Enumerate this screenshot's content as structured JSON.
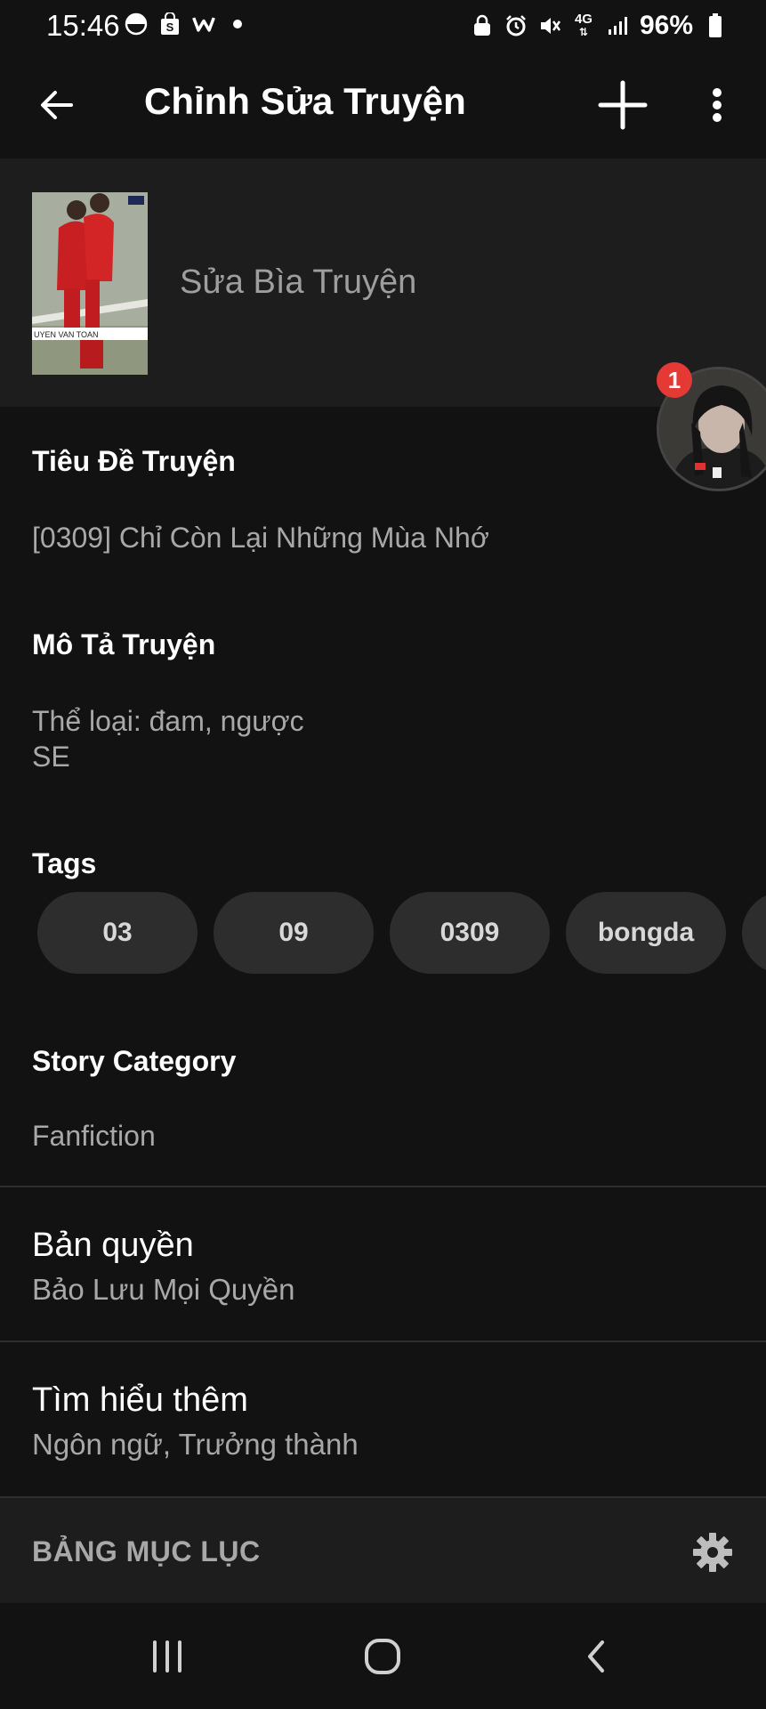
{
  "status_bar": {
    "time": "15:46",
    "battery": "96%",
    "network": "4G"
  },
  "app_bar": {
    "title": "Chỉnh Sửa Truyện"
  },
  "cover": {
    "label": "Sửa Bìa Truyện",
    "thumbnail_caption": "UYEN VAN TOAN"
  },
  "chat_bubble": {
    "badge_count": "1"
  },
  "story": {
    "title_label": "Tiêu Đề Truyện",
    "title_value": "[0309] Chỉ Còn Lại Những Mùa Nhớ",
    "description_label": "Mô Tả Truyện",
    "description_line1": "Thể loại: đam, ngược",
    "description_line2": "SE",
    "tags_label": "Tags",
    "tags": [
      "03",
      "09",
      "0309",
      "bongda"
    ],
    "category_label": "Story Category",
    "category_value": "Fanfiction"
  },
  "copyright": {
    "title": "Bản quyền",
    "subtitle": "Bảo Lưu Mọi Quyền"
  },
  "learn_more": {
    "title": "Tìm hiểu thêm",
    "subtitle": "Ngôn ngữ, Trưởng thành"
  },
  "toc": {
    "label": "BẢNG MỤC LỤC"
  },
  "colors": {
    "background": "#121212",
    "surface": "#1d1d1d",
    "chip": "#2d2d2d",
    "badge": "#e53935",
    "secondary_text": "#a8a8a8"
  },
  "icons": [
    "arrow-left-icon",
    "plus-icon",
    "more-vertical-icon",
    "gear-icon",
    "recent-apps-icon",
    "home-icon",
    "back-chevron-icon"
  ]
}
